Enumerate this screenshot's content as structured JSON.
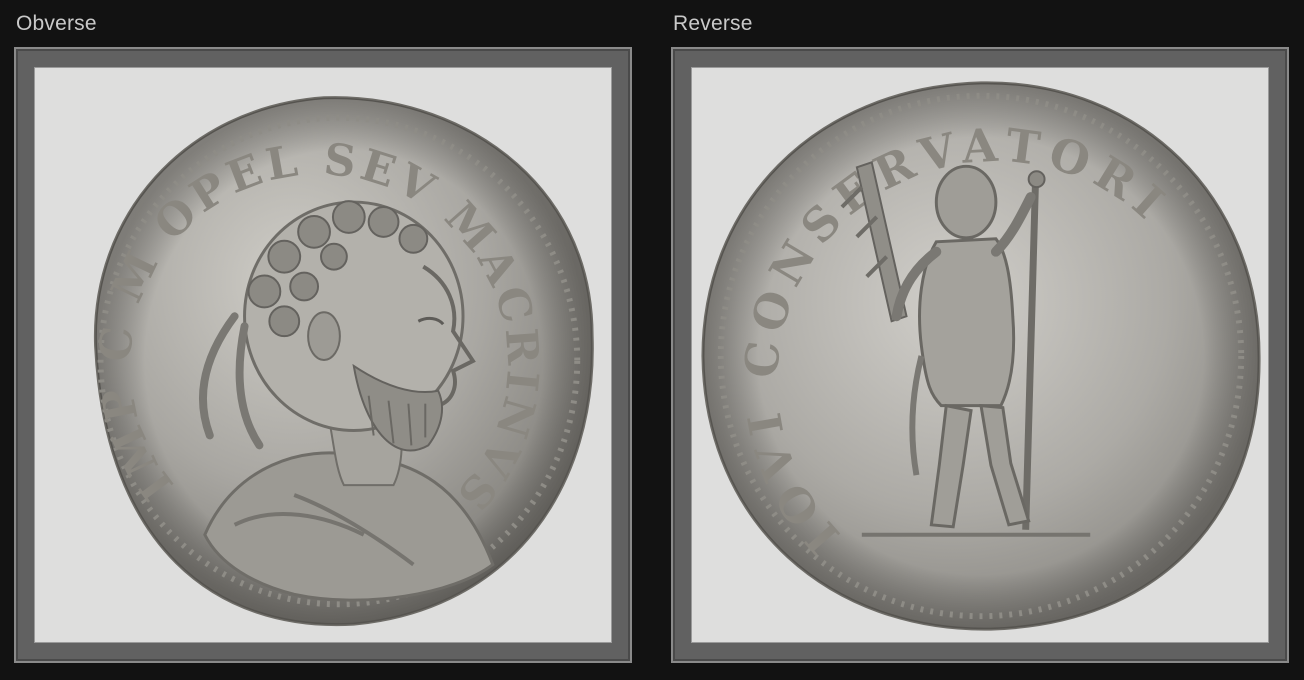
{
  "panels": [
    {
      "label": "Obverse",
      "image": "coin-obverse",
      "legend": "IMP C M OPEL SEV MACRINVS AVG"
    },
    {
      "label": "Reverse",
      "image": "coin-reverse",
      "legend": "IOVI CONSERVATORI"
    }
  ],
  "colors": {
    "background": "#121212",
    "frame": "#616161",
    "mat": "#dededd",
    "coin_silver": "#a9a7a2",
    "label": "#c9c9c9"
  }
}
